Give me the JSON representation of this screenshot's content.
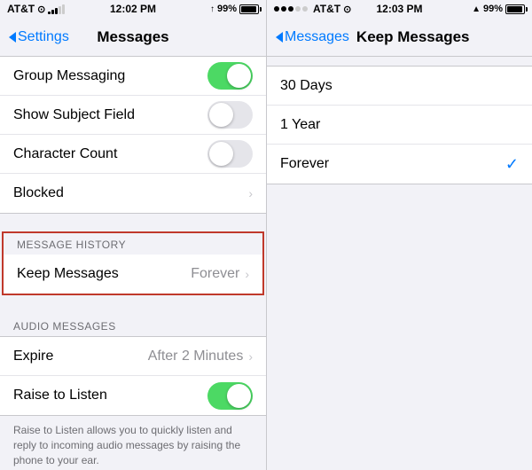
{
  "left": {
    "statusBar": {
      "carrier": "AT&T",
      "signal": "●●●○○",
      "wifi": "WiFi",
      "time": "12:02 PM",
      "gps": "↑",
      "battery": "99%"
    },
    "navBar": {
      "backLabel": "Settings",
      "title": "Messages"
    },
    "rows": [
      {
        "label": "Group Messaging",
        "type": "toggle",
        "value": "on"
      },
      {
        "label": "Show Subject Field",
        "type": "toggle",
        "value": "off"
      },
      {
        "label": "Character Count",
        "type": "toggle",
        "value": "off"
      },
      {
        "label": "Blocked",
        "type": "chevron"
      }
    ],
    "messageHistorySection": {
      "header": "MESSAGE HISTORY",
      "rows": [
        {
          "label": "Keep Messages",
          "value": "Forever",
          "type": "chevron"
        }
      ]
    },
    "audioSection": {
      "header": "AUDIO MESSAGES",
      "rows": [
        {
          "label": "Expire",
          "value": "After 2 Minutes",
          "type": "chevron"
        },
        {
          "label": "Raise to Listen",
          "type": "toggle",
          "value": "on"
        }
      ],
      "description": "Raise to Listen allows you to quickly listen and reply to incoming audio messages by raising the phone to your ear."
    }
  },
  "right": {
    "statusBar": {
      "carrier": "AT&T",
      "signal": "●●●○○",
      "wifi": "WiFi",
      "time": "12:03 PM",
      "gps": "↑",
      "battery": "99%"
    },
    "navBar": {
      "backLabel": "Messages",
      "title": "Keep Messages"
    },
    "options": [
      {
        "label": "30 Days",
        "selected": false
      },
      {
        "label": "1 Year",
        "selected": false
      },
      {
        "label": "Forever",
        "selected": true
      }
    ]
  }
}
